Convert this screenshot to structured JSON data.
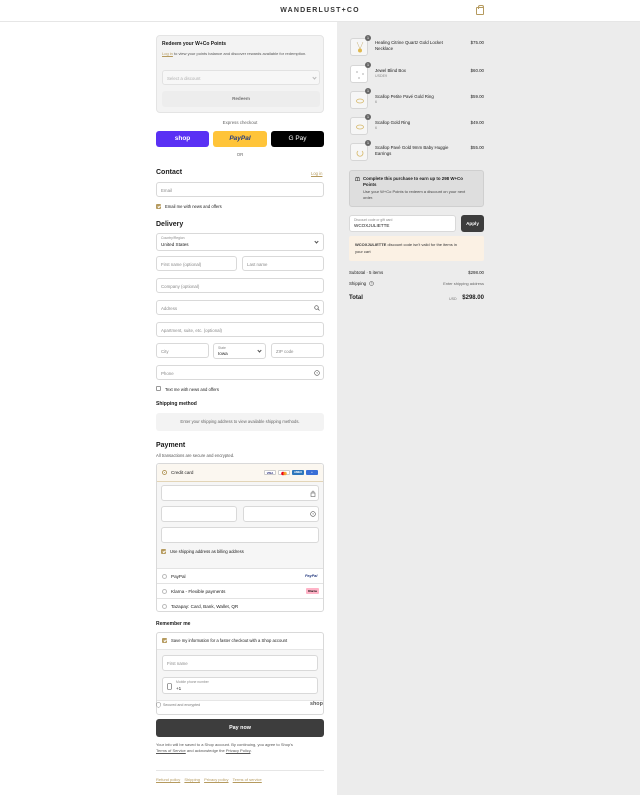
{
  "header": {
    "brand": "WANDERLUST+CO"
  },
  "redeem": {
    "title": "Redeem your W+Co Points",
    "login_link": "Log in",
    "desc_rest": " to view your points balance and discover rewards available for redemption.",
    "select_placeholder": "Select a discount",
    "button": "Redeem"
  },
  "express": {
    "label": "Express checkout",
    "shop": "shop",
    "paypal": "PayPal",
    "gpay": "G Pay",
    "or": "OR"
  },
  "contact": {
    "title": "Contact",
    "login": "Log in",
    "email_placeholder": "Email",
    "news": "Email me with news and offers"
  },
  "delivery": {
    "title": "Delivery",
    "country_label": "Country/Region",
    "country_value": "United States",
    "first_name": "First name (optional)",
    "last_name": "Last name",
    "company": "Company (optional)",
    "address": "Address",
    "apartment": "Apartment, suite, etc. (optional)",
    "city": "City",
    "state_label": "State",
    "state_value": "Iowa",
    "zip": "ZIP code",
    "phone": "Phone",
    "text_me": "Text me with news and offers"
  },
  "shipping": {
    "title": "Shipping method",
    "message": "Enter your shipping address to view available shipping methods."
  },
  "payment": {
    "title": "Payment",
    "subtitle": "All transactions are secure and encrypted.",
    "credit_card": "Credit card",
    "card_logos": [
      "VISA",
      "MC",
      "AMEX",
      "+"
    ],
    "billing_same": "Use shipping address as billing address",
    "paypal": "PayPal",
    "paypal_logo": "PayPal",
    "klarna": "Klarna - Flexible payments",
    "klarna_logo": "Klarna",
    "tazapay": "Tazapay: Card, Bank, Wallet, QR"
  },
  "remember": {
    "title": "Remember me",
    "save_info": "Save my information for a faster checkout with a Shop account",
    "first_name": "First name",
    "mobile_label": "Mobile phone number",
    "mobile_value": "+1",
    "secure": "Secured and encrypted",
    "shop_logo": "shop"
  },
  "pay_now": "Pay now",
  "legal": {
    "line1": "Your info will be saved to a Shop account. By continuing, you agree to Shop's",
    "terms": "Terms of Service",
    "mid": " and acknowledge the ",
    "privacy": "Privacy Policy",
    "end": "."
  },
  "footer_links": [
    "Refund policy",
    "Shipping",
    "Privacy policy",
    "Terms of service"
  ],
  "cart": {
    "items": [
      {
        "qty": "1",
        "name_l1": "Healing Citrine Quartz Gold Locket",
        "name_l2": "Necklace",
        "variant": "",
        "price": "$75.00"
      },
      {
        "qty": "1",
        "name_l1": "Jewel Blind Box",
        "name_l2": "",
        "variant": "USDE9",
        "price": "$60.00"
      },
      {
        "qty": "1",
        "name_l1": "Scallop Petite Pavé Gold Ring",
        "name_l2": "",
        "variant": "6",
        "price": "$59.00"
      },
      {
        "qty": "1",
        "name_l1": "Scallop Gold Ring",
        "name_l2": "",
        "variant": "6",
        "price": "$49.00"
      },
      {
        "qty": "1",
        "name_l1": "Scallop Pavé Gold 9mm Baby Huggie",
        "name_l2": "Earrings",
        "variant": "",
        "price": "$55.00"
      }
    ],
    "points_title_l1": "Complete this purchase to earn up to 298 W+Co",
    "points_title_l2": "Points",
    "points_desc_l1": "Use your W+Co Points to redeem a discount on your next",
    "points_desc_l2": "order.",
    "discount_label": "Discount code or gift card",
    "discount_value": "WCOXJULIETTE",
    "apply": "Apply",
    "error_code": "WCOXJULIETTE",
    "error_l1": " discount code isn't valid for the items in",
    "error_l2": "your cart",
    "subtotal_label": "Subtotal · 5 items",
    "subtotal_value": "$298.00",
    "shipping_label": "Shipping",
    "shipping_value": "Enter shipping address",
    "total_label": "Total",
    "currency": "USD",
    "total_value": "$298.00"
  },
  "colors": {
    "accent": "#b59a5e",
    "shop": "#5a31f4",
    "paypal": "#ffc439",
    "button_dark": "#3d3d3d"
  }
}
